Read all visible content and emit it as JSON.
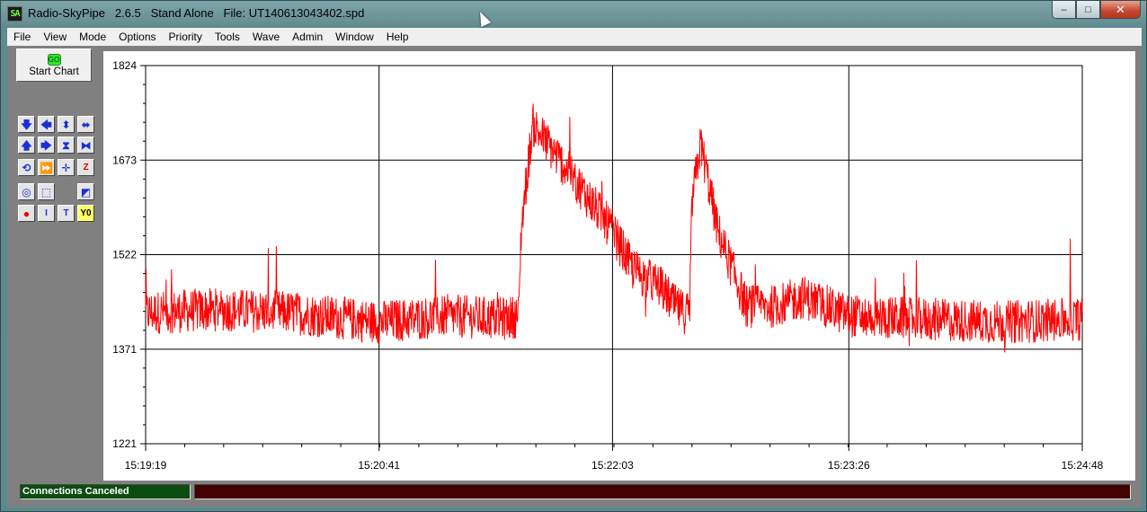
{
  "window": {
    "app_icon_text": "SA",
    "title": "Radio-SkyPipe   2.6.5   Stand Alone   File: UT140613043402.spd",
    "controls": {
      "minimize": "–",
      "maximize": "□",
      "close": "✕"
    }
  },
  "menu": [
    "File",
    "View",
    "Mode",
    "Options",
    "Priority",
    "Tools",
    "Wave",
    "Admin",
    "Window",
    "Help"
  ],
  "toolbar": {
    "start_chart_icon": "GO",
    "start_chart_label": "Start Chart",
    "tools": [
      {
        "name": "scroll-down-icon",
        "glyph": "🡇",
        "style": ""
      },
      {
        "name": "scroll-left-icon",
        "glyph": "🡄",
        "style": ""
      },
      {
        "name": "expand-vertical-icon",
        "glyph": "⬍",
        "style": ""
      },
      {
        "name": "expand-horizontal-icon",
        "glyph": "⬌",
        "style": ""
      },
      {
        "name": "scroll-up-icon",
        "glyph": "🡅",
        "style": ""
      },
      {
        "name": "scroll-right-icon",
        "glyph": "🡆",
        "style": ""
      },
      {
        "name": "compress-vertical-icon",
        "glyph": "⧗",
        "style": ""
      },
      {
        "name": "compress-horizontal-icon",
        "glyph": "⧓",
        "style": ""
      },
      {
        "name": "refresh-icon",
        "glyph": "⟲",
        "style": ""
      },
      {
        "name": "fast-forward-icon",
        "glyph": "⏩",
        "style": "gray"
      },
      {
        "name": "crosshair-icon",
        "glyph": "✛",
        "style": ""
      },
      {
        "name": "zoom-box-icon",
        "glyph": "Z",
        "style": "red box"
      },
      {
        "name": "zoom-circle-icon",
        "glyph": "◎",
        "style": ""
      },
      {
        "name": "select-region-icon",
        "glyph": "⬚",
        "style": ""
      },
      {
        "name": "strip-chart-icon",
        "glyph": "◩",
        "style": ""
      },
      {
        "name": "record-icon",
        "glyph": "●",
        "style": "red"
      },
      {
        "name": "insert-marker-icon",
        "glyph": "I",
        "style": "box"
      },
      {
        "name": "text-annotation-icon",
        "glyph": "T",
        "style": "box"
      },
      {
        "name": "y-zero-icon",
        "glyph": "Y0",
        "style": "yel"
      }
    ]
  },
  "chart_data": {
    "type": "line",
    "title": "",
    "xlabel": "",
    "ylabel": "",
    "color": "#ff0000",
    "grid": true,
    "ylim": [
      1221,
      1824
    ],
    "y_ticks": [
      "1824",
      "1673",
      "1522",
      "1371",
      "1221"
    ],
    "x_ticks": [
      "15:19:19",
      "15:20:41",
      "15:22:03",
      "15:23:26",
      "15:24:48"
    ],
    "series": [
      {
        "x": [
          "15:19:19",
          "15:19:45",
          "15:20:10",
          "15:20:41",
          "15:21:05",
          "15:21:25",
          "15:21:30",
          "15:21:31",
          "15:21:35",
          "15:21:45",
          "15:21:55",
          "15:22:03",
          "15:22:10",
          "15:22:20",
          "15:22:25",
          "15:22:30",
          "15:22:31",
          "15:22:34",
          "15:22:40",
          "15:22:50",
          "15:23:00",
          "15:23:10",
          "15:23:26",
          "15:23:50",
          "15:24:20",
          "15:24:48"
        ],
        "values": [
          1430,
          1435,
          1430,
          1415,
          1425,
          1420,
          1425,
          1570,
          1730,
          1670,
          1610,
          1560,
          1500,
          1470,
          1440,
          1425,
          1610,
          1700,
          1560,
          1440,
          1440,
          1455,
          1425,
          1420,
          1415,
          1420
        ]
      }
    ]
  },
  "status": {
    "left": "Connections Canceled",
    "right": ""
  }
}
